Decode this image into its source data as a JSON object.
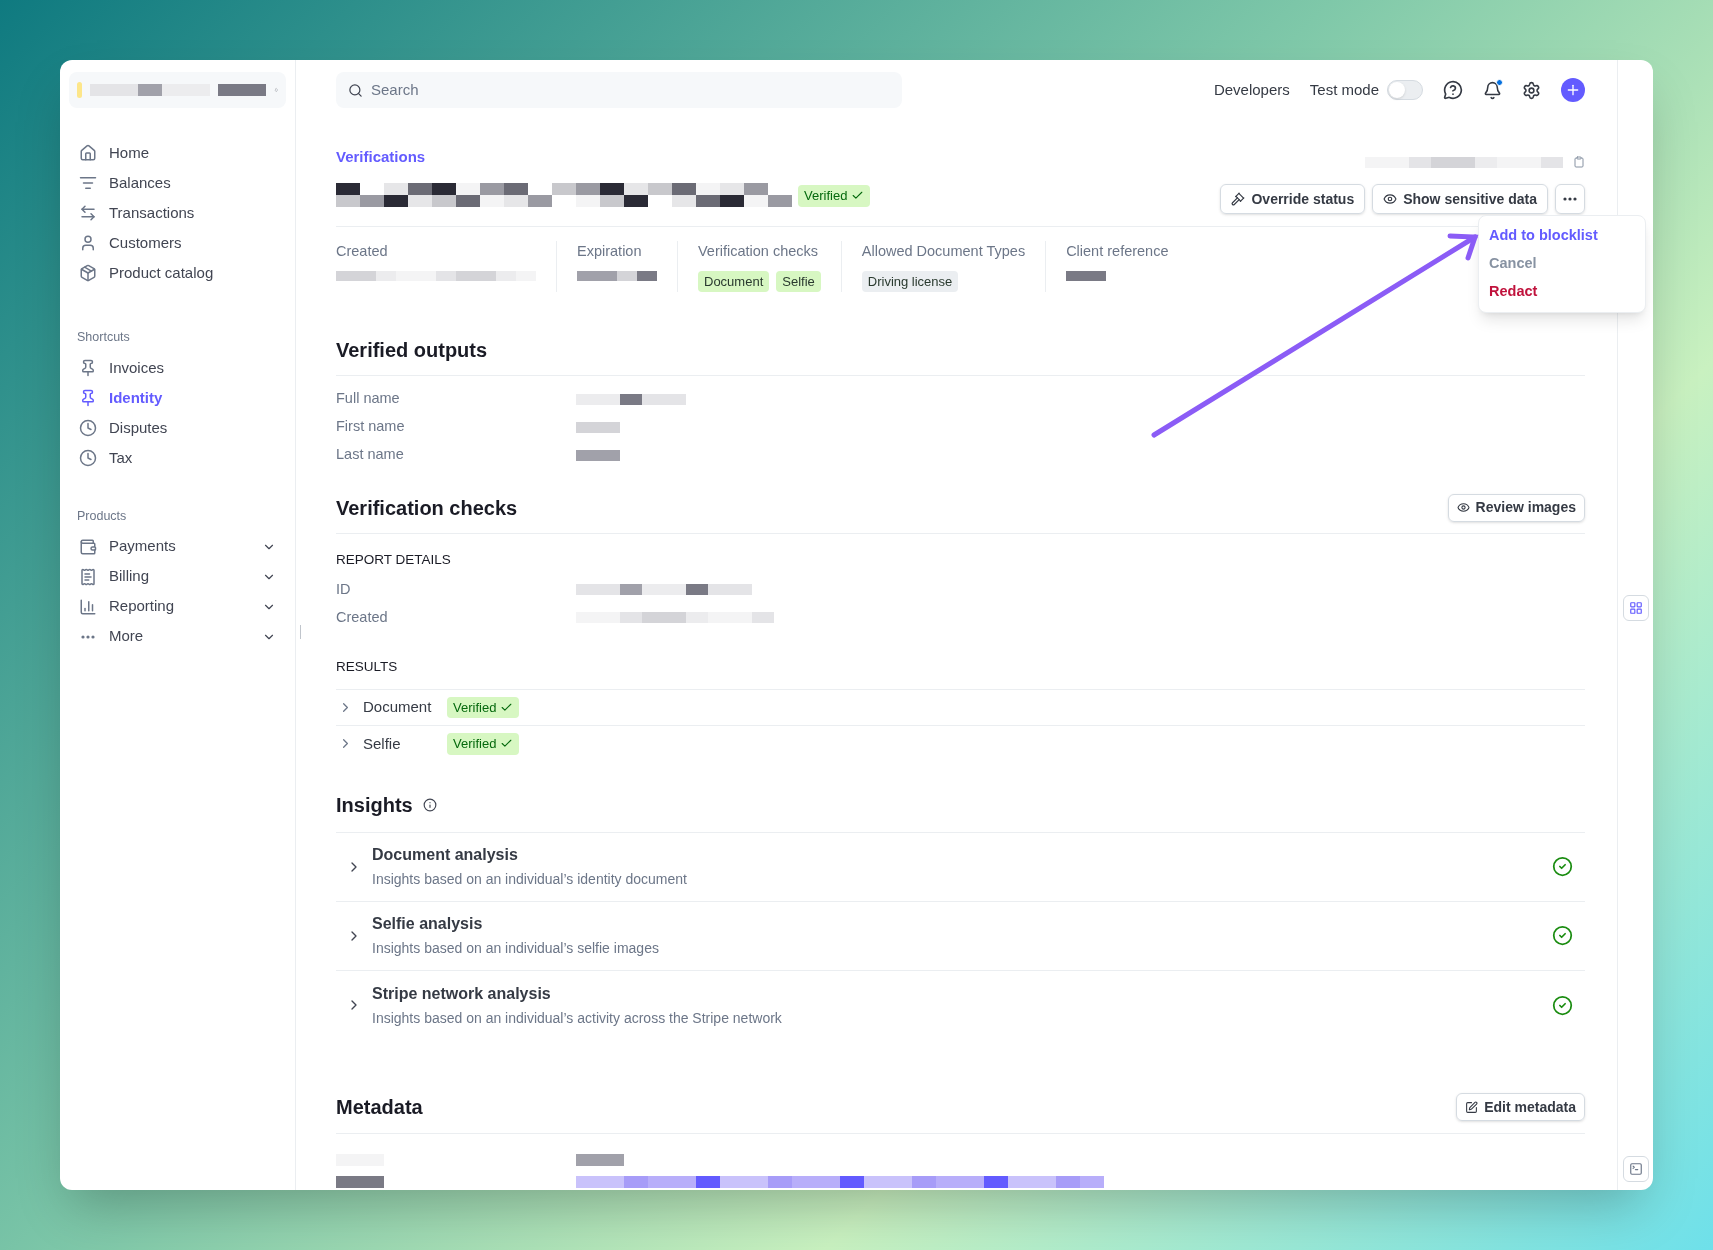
{
  "sidebar": {
    "nav": [
      {
        "label": "Home",
        "selected": false
      },
      {
        "label": "Balances",
        "selected": false
      },
      {
        "label": "Transactions",
        "selected": false
      },
      {
        "label": "Customers",
        "selected": false
      },
      {
        "label": "Product catalog",
        "selected": false
      }
    ],
    "shortcuts": {
      "title": "Shortcuts",
      "items": [
        {
          "label": "Invoices",
          "selected": false
        },
        {
          "label": "Identity",
          "selected": true
        },
        {
          "label": "Disputes",
          "selected": false
        },
        {
          "label": "Tax",
          "selected": false
        }
      ]
    },
    "products": {
      "title": "Products",
      "items": [
        {
          "label": "Payments",
          "expanded": false
        },
        {
          "label": "Billing",
          "expanded": false
        },
        {
          "label": "Reporting",
          "expanded": false
        },
        {
          "label": "More",
          "expanded": false
        }
      ]
    }
  },
  "topbar": {
    "search": {
      "placeholder": "Search"
    },
    "developers": "Developers",
    "test_mode": {
      "label": "Test mode",
      "on": false
    },
    "notifications": {
      "unread": true
    }
  },
  "header": {
    "breadcrumb": "Verifications",
    "status": "Verified",
    "buttons": [
      "Override status",
      "Show sensitive data"
    ]
  },
  "menu": [
    {
      "label": "Add to blocklist",
      "color": "#635bff"
    },
    {
      "label": "Cancel",
      "color": "#8792a2"
    },
    {
      "label": "Redact",
      "color": "#c0123c"
    }
  ],
  "summary": [
    {
      "label": "Created",
      "kind": "redacted"
    },
    {
      "label": "Expiration",
      "kind": "redacted"
    },
    {
      "label": "Verification checks",
      "kind": "tags",
      "tags": [
        {
          "label": "Document",
          "color": "#d7f7c2"
        },
        {
          "label": "Selfie",
          "color": "#d7f7c2"
        }
      ]
    },
    {
      "label": "Allowed Document Types",
      "kind": "tags",
      "tags": [
        {
          "label": "Driving license",
          "color": "#ebeef1"
        }
      ]
    },
    {
      "label": "Client reference",
      "kind": "redacted"
    }
  ],
  "verified_outputs": {
    "title": "Verified outputs",
    "rows": [
      "Full name",
      "First name",
      "Last name"
    ]
  },
  "verification_checks": {
    "title": "Verification checks",
    "button": "Review images",
    "report_title": "REPORT DETAILS",
    "report_rows": [
      "ID",
      "Created"
    ],
    "results_title": "RESULTS",
    "results": [
      {
        "name": "Document",
        "status": "Verified",
        "expanded": false
      },
      {
        "name": "Selfie",
        "status": "Verified",
        "expanded": false
      }
    ]
  },
  "insights": {
    "title": "Insights",
    "items": [
      {
        "title": "Document analysis",
        "description": "Insights based on an individual’s identity document",
        "passed": true,
        "expanded": false
      },
      {
        "title": "Selfie analysis",
        "description": "Insights based on an individual’s selfie images",
        "passed": true,
        "expanded": false
      },
      {
        "title": "Stripe network analysis",
        "description": "Insights based on an individual’s activity across the Stripe network",
        "passed": true,
        "expanded": false
      }
    ]
  },
  "metadata": {
    "title": "Metadata",
    "button": "Edit metadata"
  }
}
